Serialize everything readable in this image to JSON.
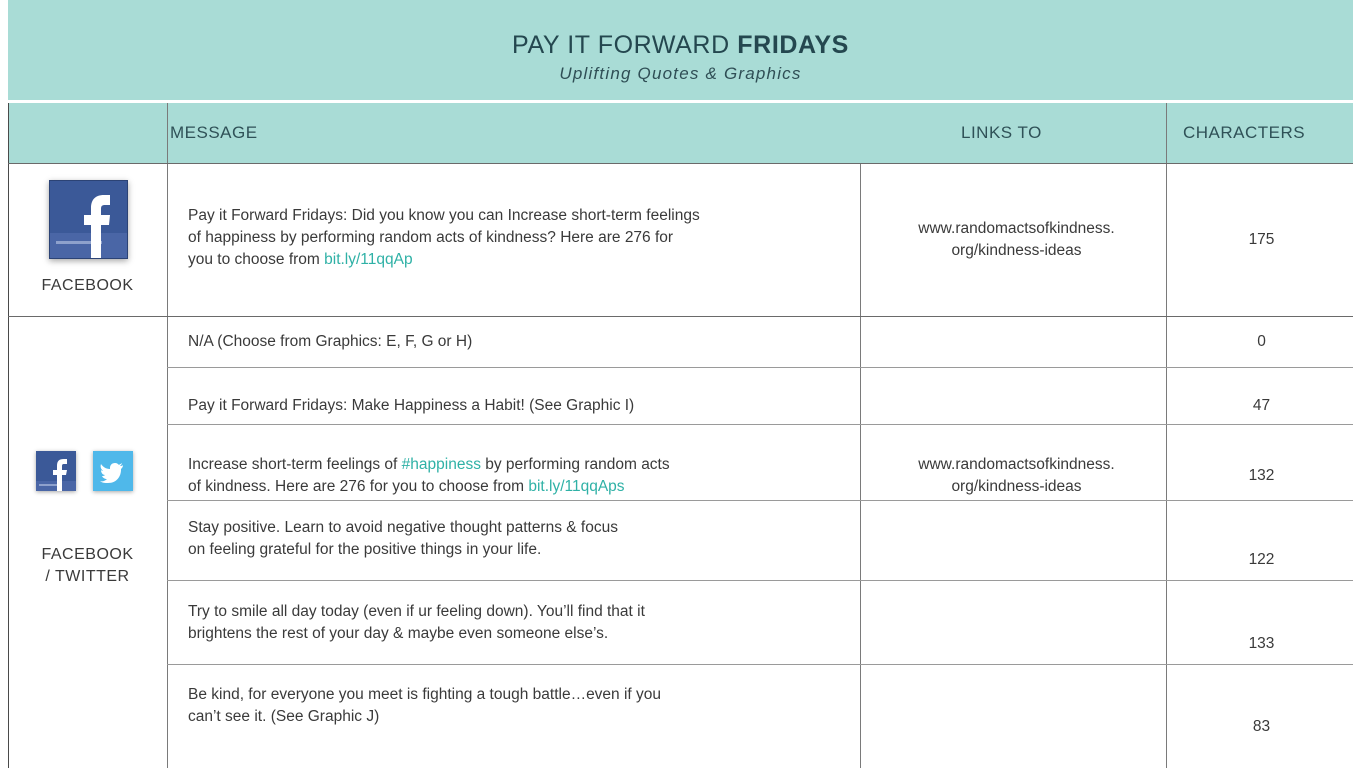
{
  "header": {
    "title_plain": "PAY IT FORWARD",
    "title_bold": "FRIDAYS",
    "subtitle": "Uplifting Quotes & Graphics"
  },
  "columns": {
    "message": "MESSAGE",
    "links_to": "LINKS TO",
    "characters": "CHARACTERS"
  },
  "facebook": {
    "label": "FACEBOOK",
    "icon": "facebook-icon",
    "row": {
      "message_line1": "Pay it Forward Fridays: Did you know you can Increase short-term feelings",
      "message_line2": "of happiness by performing random acts of kindness? Here are 276 for",
      "message_line3_prefix": "you to choose from ",
      "message_link": "bit.ly/11qqAp",
      "links_line1": "www.randomactsofkindness.",
      "links_line2": "org/kindness-ideas",
      "characters": "175"
    }
  },
  "facebook_twitter": {
    "label_line1": "FACEBOOK",
    "label_line2": "/ TWITTER",
    "icons": [
      "facebook-icon",
      "twitter-icon"
    ],
    "rows": [
      {
        "line1": "N/A (Choose from Graphics: E, F, G or H)",
        "characters": "0"
      },
      {
        "line1": "Pay it Forward Fridays: Make Happiness a Habit! (See Graphic I)",
        "characters": "47"
      },
      {
        "line1_prefix": "Increase short-term feelings of ",
        "line1_link": "#happiness",
        "line1_suffix": " by performing random acts",
        "line2_prefix": "of kindness. Here are 276 for you to choose from ",
        "line2_link": "bit.ly/11qqAps",
        "links_line1": "www.randomactsofkindness.",
        "links_line2": "org/kindness-ideas",
        "characters": "132"
      },
      {
        "line1": "Stay positive. Learn to avoid negative thought patterns & focus",
        "line2": "on feeling grateful for the positive things in your life.",
        "characters": "122"
      },
      {
        "line1": "Try to smile all day today (even if ur feeling down). You’ll find that it",
        "line2": "brightens the rest of your day & maybe even someone else’s.",
        "characters": "133"
      },
      {
        "line1": "Be kind, for everyone you meet is fighting a tough battle…even if you",
        "line2": "can’t see it. (See Graphic J)",
        "characters": "83"
      }
    ]
  },
  "colors": {
    "band": "#a9dcd6",
    "link": "#2fb1a6",
    "facebook": "#3b5998",
    "twitter": "#4fb8ea"
  }
}
